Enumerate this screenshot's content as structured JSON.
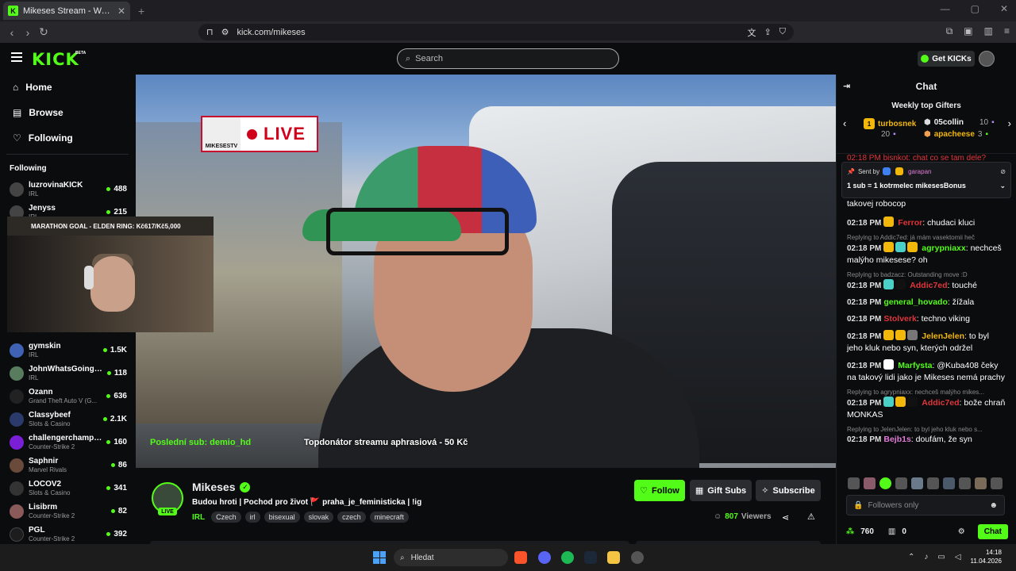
{
  "browser": {
    "tab_title": "Mikeses Stream - Watch Live on Kick",
    "url": "kick.com/mikeses",
    "new_tab": "+"
  },
  "header": {
    "logo": "KICK",
    "beta": "BETA",
    "search_placeholder": "Search",
    "get_kicks": "Get KICKs"
  },
  "sidebar": {
    "nav": [
      {
        "label": "Home",
        "icon": "home-icon"
      },
      {
        "label": "Browse",
        "icon": "browse-icon"
      },
      {
        "label": "Following",
        "icon": "heart-icon"
      }
    ],
    "following_title": "Following",
    "following": [
      {
        "name": "luzrovinaKICK",
        "category": "IRL",
        "viewers": "488"
      },
      {
        "name": "Jenyss",
        "category": "IRL",
        "viewers": "215"
      },
      {
        "name": "gymskin",
        "category": "IRL",
        "viewers": "1.5K"
      },
      {
        "name": "JohnWhatsGoingOn",
        "category": "IRL",
        "viewers": "118"
      },
      {
        "name": "Ozann",
        "category": "Grand Theft Auto V (G...",
        "viewers": "636"
      },
      {
        "name": "Classybeef",
        "category": "Slots & Casino",
        "viewers": "2.1K"
      },
      {
        "name": "challengerchampi...",
        "category": "Counter-Strike 2",
        "viewers": "160"
      },
      {
        "name": "Saphnir",
        "category": "Marvel Rivals",
        "viewers": "86"
      },
      {
        "name": "LOCOV2",
        "category": "Slots & Casino",
        "viewers": "341"
      },
      {
        "name": "Lisibrm",
        "category": "Counter-Strike 2",
        "viewers": "82"
      },
      {
        "name": "PGL",
        "category": "Counter-Strike 2",
        "viewers": "392"
      }
    ]
  },
  "webcam": {
    "goal": "MARATHON GOAL - ELDEN RING: Kč617/Kč5,000"
  },
  "video": {
    "live_badge": "LIVE",
    "badge_logo": "MIKESESTV",
    "last_sub": "Poslední sub: demio_hd",
    "top_donator": "Topdonátor streamu aphrasiová - 50 Kč"
  },
  "channel": {
    "name": "Mikeses",
    "live": "LIVE",
    "title": "Budou hroti | Pochod pro život 🚩 praha_je_feministicka | !ig",
    "category": "IRL",
    "tags": [
      "Czech",
      "irl",
      "bisexual",
      "slovak",
      "czech",
      "minecraft"
    ],
    "follow": "Follow",
    "gift_subs": "Gift Subs",
    "subscribe": "Subscribe",
    "viewers": "807",
    "viewers_label": "Viewers"
  },
  "chat": {
    "title": "Chat",
    "weekly_title": "Weekly top Gifters",
    "gifters": [
      {
        "rank": "1",
        "name": "turbosnek",
        "count": "20"
      },
      {
        "name": "05collin",
        "count": "10"
      },
      {
        "name": "apacheese",
        "count": "3"
      }
    ],
    "partial_top": "02:18 PM bisnkot: chat co se tam dele?",
    "pinned_sent_by": "Sent by",
    "pinned_user": "garapan",
    "pinned_text": "1 sub = 1 kotrmelec mikesesBonus",
    "partial_cut": "takovej robocop",
    "messages": [
      {
        "reply": "",
        "time": "02:18 PM",
        "user": "Ferror",
        "color": "#e0353a",
        "text": "chudaci kluci"
      },
      {
        "reply": "Replying to Addic7ed: já mám vasektomii heč",
        "time": "02:18 PM",
        "user": "agrypniaxx",
        "color": "#53fc18",
        "text": "nechceš malýho mikesese? oh"
      },
      {
        "reply": "Replying to badzacz: Outstanding move :D",
        "time": "02:18 PM",
        "user": "Addic7ed",
        "color": "#e0353a",
        "text": "touché"
      },
      {
        "reply": "",
        "time": "02:18 PM",
        "user": "general_hovado",
        "color": "#53fc18",
        "text": "žížala"
      },
      {
        "reply": "",
        "time": "02:18 PM",
        "user": "Stolverk",
        "color": "#e0353a",
        "text": "techno viking"
      },
      {
        "reply": "",
        "time": "02:18 PM",
        "user": "JelenJelen",
        "color": "#f1b70b",
        "text": "to byl jeho kluk nebo syn, kterých održel"
      },
      {
        "reply": "",
        "time": "02:18 PM",
        "user": "Marfysta",
        "color": "#53fc18",
        "text": "@Kuba408 čeky na takový lidi jako je Mikeses nemá prachy"
      },
      {
        "reply": "Replying to agrypniaxx: nechceš malýho mikes...",
        "time": "02:18 PM",
        "user": "Addic7ed",
        "color": "#e0353a",
        "text": "bože chraň MONKAS"
      },
      {
        "reply": "Replying to JelenJelen: to byl jeho kluk nebo s...",
        "time": "02:18 PM",
        "user": "Bejb1s",
        "color": "#e27bd6",
        "text": "doufám, že syn"
      }
    ],
    "input_placeholder": "Followers only",
    "kicks": "760",
    "zero": "0",
    "chat_button": "Chat"
  },
  "taskbar": {
    "search": "Hledat",
    "time": "14:18",
    "date": "11.04.2026"
  }
}
